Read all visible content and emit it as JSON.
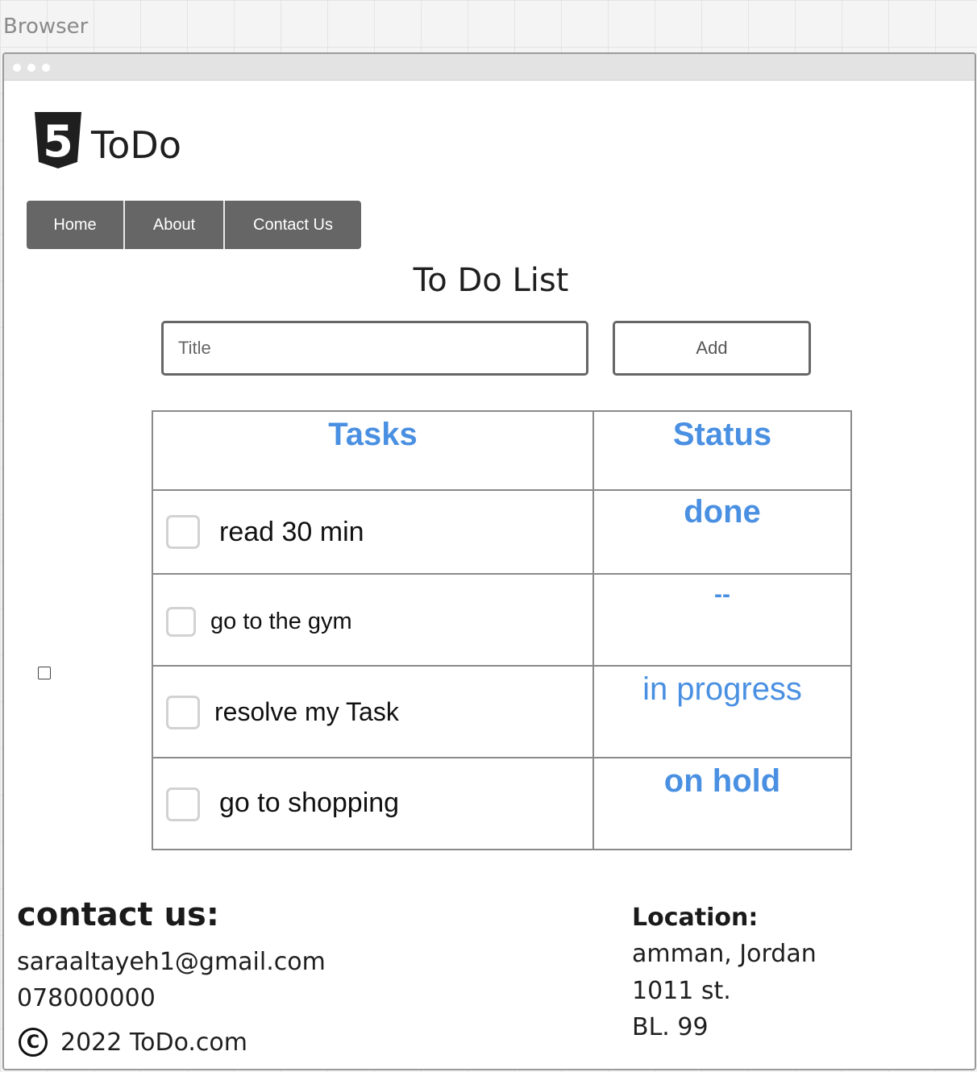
{
  "canvas": {
    "label": "Browser"
  },
  "app": {
    "title": "ToDo",
    "logo_icon": "html5-icon",
    "logo_glyph": "5"
  },
  "nav": {
    "items": [
      {
        "label": "Home"
      },
      {
        "label": "About"
      },
      {
        "label": "Contact Us"
      }
    ]
  },
  "main": {
    "heading": "To Do List",
    "input": {
      "placeholder": "Title",
      "value": ""
    },
    "add_button": "Add"
  },
  "table": {
    "headers": {
      "tasks": "Tasks",
      "status": "Status"
    },
    "rows": [
      {
        "task": "read 30 min",
        "status": "done",
        "checked": false
      },
      {
        "task": "go to the gym",
        "status": "--",
        "checked": false
      },
      {
        "task": "resolve my Task",
        "status": "in progress",
        "checked": false
      },
      {
        "task": "go to shopping",
        "status": "on hold",
        "checked": false
      }
    ]
  },
  "footer": {
    "contact": {
      "heading": "contact us:",
      "email": "saraaltayeh1@gmail.com",
      "phone": "078000000"
    },
    "copyright": {
      "symbol": "C",
      "text": "2022 ToDo.com"
    },
    "location": {
      "heading": "Location:",
      "lines": [
        "amman, Jordan",
        "1011 st.",
        "BL. 99"
      ]
    }
  },
  "colors": {
    "accent": "#4a90e2",
    "nav_background": "#666666",
    "border": "#8a8a8a"
  }
}
